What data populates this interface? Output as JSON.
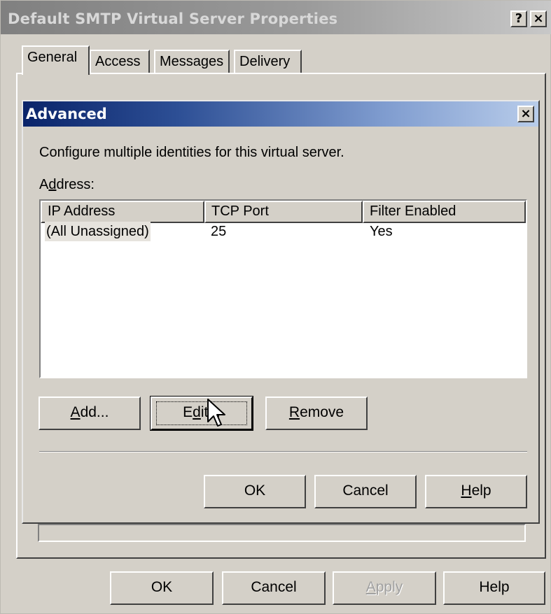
{
  "window": {
    "title": "Default SMTP Virtual Server Properties",
    "help_glyph": "?",
    "close_glyph": "×"
  },
  "tabs": [
    {
      "label": "General",
      "active": true
    },
    {
      "label": "Access",
      "active": false
    },
    {
      "label": "Messages",
      "active": false
    },
    {
      "label": "Delivery",
      "active": false
    }
  ],
  "dialog": {
    "title": "Advanced",
    "close_glyph": "×",
    "description": "Configure multiple identities for this virtual server.",
    "address_label_pre": "A",
    "address_label_ul": "d",
    "address_label_post": "dress:",
    "columns": [
      "IP Address",
      "TCP Port",
      "Filter Enabled"
    ],
    "rows": [
      {
        "ip": "(All Unassigned)",
        "port": "25",
        "filter": "Yes"
      }
    ],
    "buttons": {
      "add": {
        "ul": "A",
        "rest": "dd..."
      },
      "edit": {
        "pre": "E",
        "ul": "d",
        "rest": "it..."
      },
      "remove": {
        "ul": "R",
        "rest": "emove"
      },
      "ok": "OK",
      "cancel": "Cancel",
      "help": {
        "ul": "H",
        "rest": "elp"
      }
    }
  },
  "footer": {
    "ok": "OK",
    "cancel": "Cancel",
    "apply": {
      "ul": "A",
      "rest": "pply",
      "enabled": false
    },
    "help": "Help"
  },
  "colors": {
    "dialog_face": "#d4d0c8",
    "active_title_start": "#0a246a",
    "active_title_end": "#b8ccea",
    "inactive_title": "#808080"
  },
  "icons": {
    "cursor": "arrow-cursor"
  }
}
